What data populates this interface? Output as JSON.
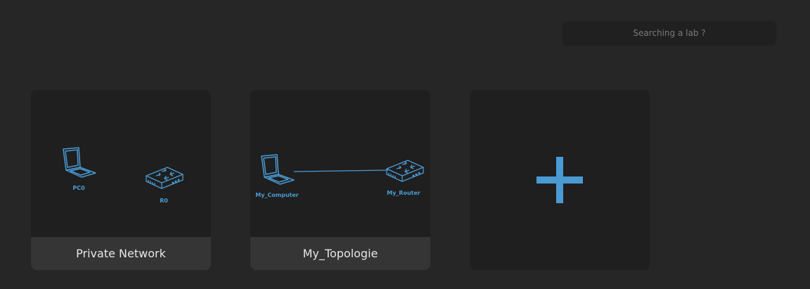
{
  "search": {
    "placeholder": "Searching a lab ?"
  },
  "labs": [
    {
      "title": "Private Network",
      "nodes": [
        {
          "label": "PC0",
          "type": "laptop"
        },
        {
          "label": "R0",
          "type": "router"
        }
      ],
      "links": 0
    },
    {
      "title": "My_Topologie",
      "nodes": [
        {
          "label": "My_Computer",
          "type": "laptop"
        },
        {
          "label": "My_Router",
          "type": "router"
        }
      ],
      "links": 1
    }
  ],
  "add_card": {
    "icon": "plus-icon"
  },
  "colors": {
    "background": "#262626",
    "card": "#1f1f1f",
    "card_footer": "#353535",
    "accent": "#4a9bd4"
  }
}
